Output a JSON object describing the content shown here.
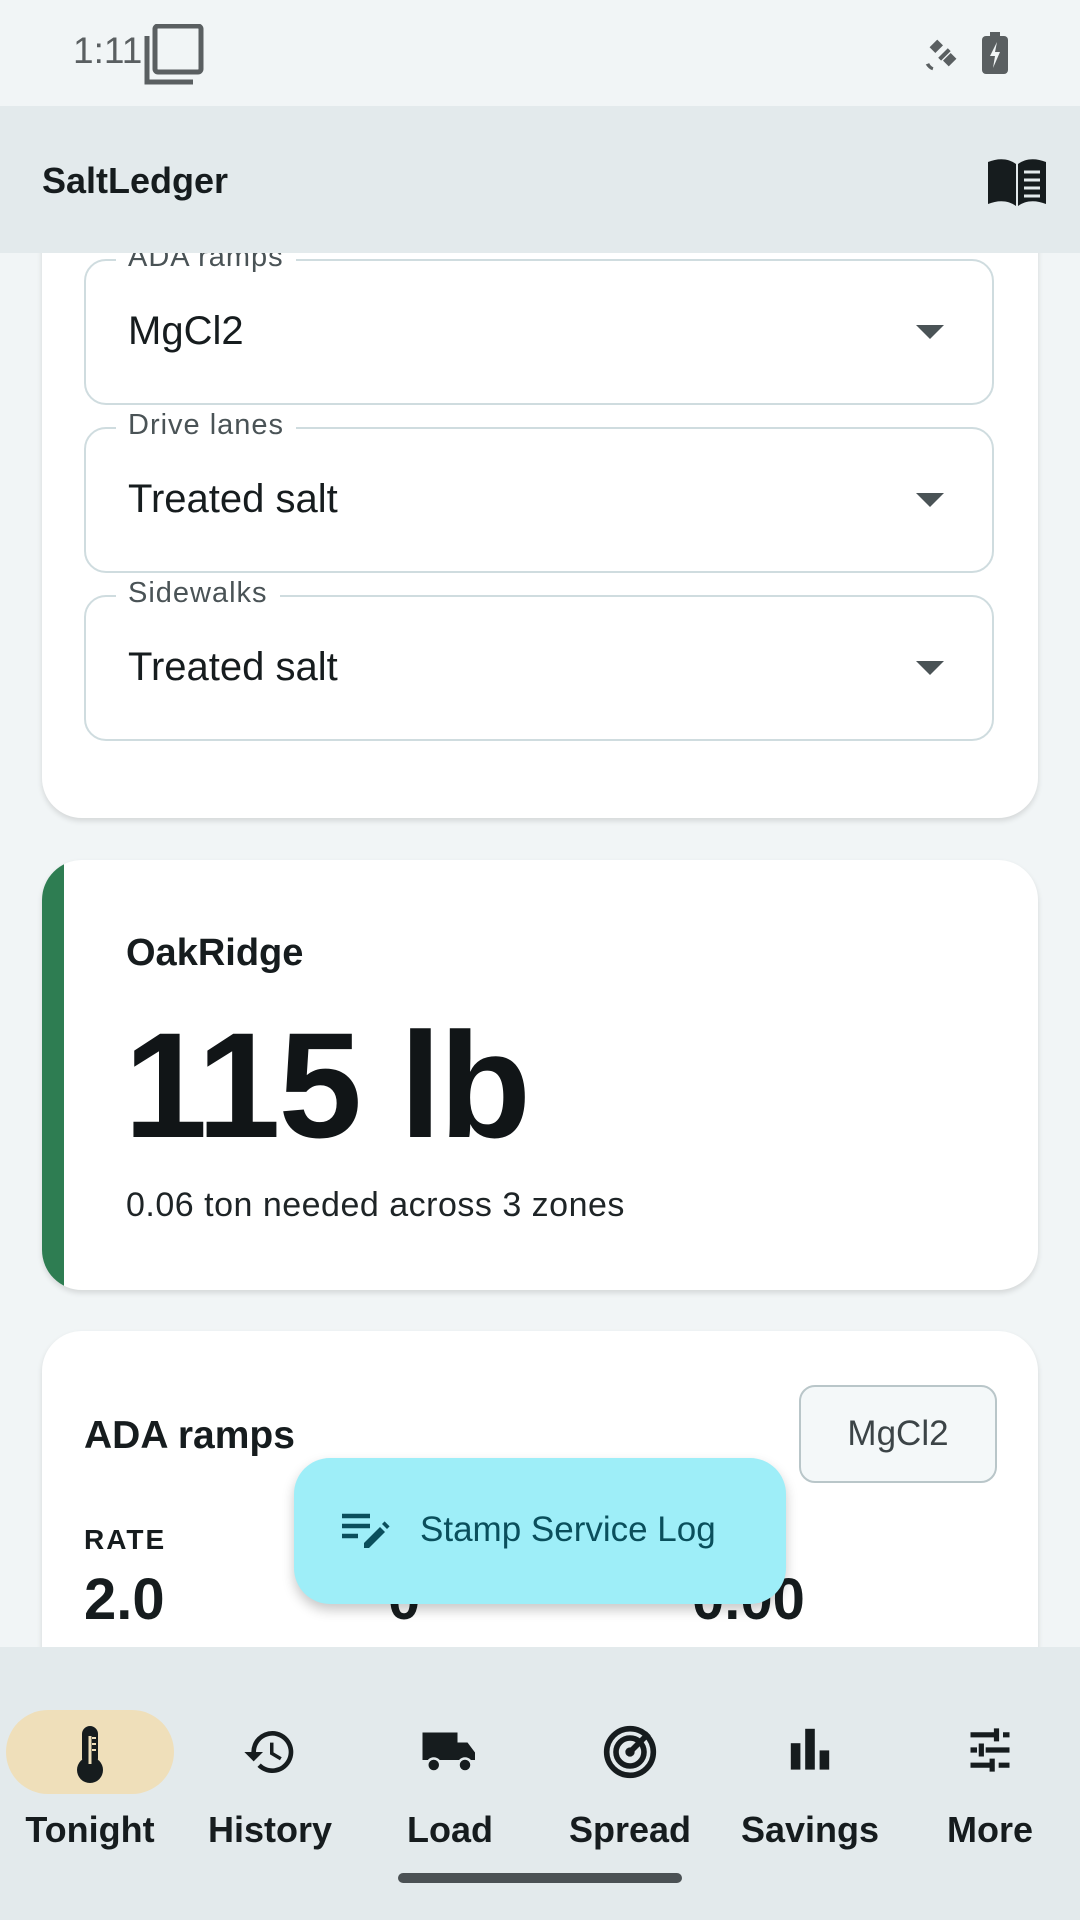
{
  "status_bar": {
    "time": "1:11"
  },
  "app_bar": {
    "title": "SaltLedger"
  },
  "material_selects": [
    {
      "label": "ADA ramps",
      "value": "MgCl2"
    },
    {
      "label": "Drive lanes",
      "value": "Treated salt"
    },
    {
      "label": "Sidewalks",
      "value": "Treated salt"
    }
  ],
  "summary": {
    "site": "OakRidge",
    "amount": "115 lb",
    "note": "0.06 ton needed across 3 zones",
    "accent_color": "#2e7d52"
  },
  "zone_card": {
    "title": "ADA ramps",
    "chip": "MgCl2",
    "stats": [
      {
        "label": "RATE",
        "value": "2.0"
      },
      {
        "label": "",
        "value": "0"
      },
      {
        "label": "",
        "value": "0.00"
      }
    ]
  },
  "fab": {
    "label": "Stamp Service Log",
    "icon": "edit-note-icon"
  },
  "bottom_nav": {
    "items": [
      {
        "label": "Tonight",
        "icon": "thermometer-icon",
        "active": true
      },
      {
        "label": "History",
        "icon": "history-icon",
        "active": false
      },
      {
        "label": "Load",
        "icon": "truck-icon",
        "active": false
      },
      {
        "label": "Spread",
        "icon": "target-icon",
        "active": false
      },
      {
        "label": "Savings",
        "icon": "bar-chart-icon",
        "active": false
      },
      {
        "label": "More",
        "icon": "sliders-icon",
        "active": false
      }
    ]
  }
}
